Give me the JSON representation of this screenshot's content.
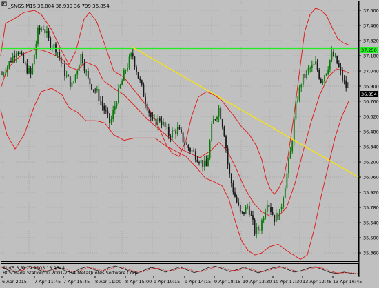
{
  "window": {
    "icon_name": "chart-window-icon",
    "title": "_SNGS,M15",
    "ohlc": "36.804 36.939 36.799 36.854"
  },
  "colors": {
    "background": "#c0c0c0",
    "grid": "#a8a8a8",
    "bull_candle": "#0a7a0a",
    "bear_candle": "#1a1a1a",
    "bollinger": "#e02020",
    "resistance_line": "#22ee22",
    "trend_line": "#f0e020",
    "price_tag": "#000000",
    "stochastic_main": "#1a1a1a",
    "stochastic_signal": "#e02020"
  },
  "indicator": {
    "label": "Sto(5,3,3) 19.3103 13.9544"
  },
  "footer": {
    "copyright": "BCS Trade Station, © 2001-2014 MetaQuotes Software Corp."
  },
  "chart_data": {
    "type": "candlestick",
    "symbol": "_SNGS",
    "timeframe": "M15",
    "y_ticks": [
      "37.600",
      "37.460",
      "37.320",
      "37.180",
      "37.040",
      "36.900",
      "36.760",
      "36.620",
      "36.480",
      "36.340",
      "36.200",
      "36.060",
      "35.920",
      "35.780",
      "35.640",
      "35.500",
      "35.360"
    ],
    "ylim": [
      35.36,
      37.6
    ],
    "x_ticks": [
      "6 Apr 2015",
      "7 Apr 11:45",
      "7 Apr 15:45",
      "8 Apr 11:00",
      "8 Apr 15:00",
      "9 Apr 10:15",
      "9 Apr 14:15",
      "9 Apr 18:15",
      "10 Apr 13:30",
      "10 Apr 17:30",
      "13 Apr 12:45",
      "13 Apr 16:45"
    ],
    "current_price": "36.854",
    "resistance_level": "37.250",
    "trend_line": {
      "start": [
        "8 Apr 15:00",
        37.26
      ],
      "end": [
        "13 Apr 16:45",
        36.06
      ]
    },
    "bollinger_upper": [
      [
        1,
        37.18
      ],
      [
        8,
        37.48
      ],
      [
        20,
        37.52
      ],
      [
        35,
        37.58
      ],
      [
        50,
        37.6
      ],
      [
        60,
        37.56
      ],
      [
        75,
        37.42
      ],
      [
        90,
        37.22
      ],
      [
        100,
        37.1
      ],
      [
        110,
        37.22
      ],
      [
        122,
        37.52
      ],
      [
        130,
        37.58
      ],
      [
        140,
        37.5
      ],
      [
        150,
        37.32
      ],
      [
        165,
        37.04
      ],
      [
        180,
        36.98
      ],
      [
        195,
        36.86
      ],
      [
        205,
        36.78
      ],
      [
        215,
        36.7
      ],
      [
        225,
        36.6
      ],
      [
        235,
        36.45
      ],
      [
        242,
        36.35
      ],
      [
        250,
        36.28
      ],
      [
        260,
        36.25
      ],
      [
        270,
        36.4
      ],
      [
        278,
        36.62
      ],
      [
        288,
        36.8
      ],
      [
        300,
        36.85
      ],
      [
        310,
        36.82
      ],
      [
        320,
        36.78
      ],
      [
        330,
        36.7
      ],
      [
        340,
        36.62
      ],
      [
        350,
        36.53
      ],
      [
        362,
        36.45
      ],
      [
        372,
        36.35
      ],
      [
        380,
        36.22
      ],
      [
        386,
        36.05
      ],
      [
        392,
        35.95
      ],
      [
        398,
        35.9
      ],
      [
        405,
        35.96
      ],
      [
        412,
        36.06
      ],
      [
        418,
        36.25
      ],
      [
        426,
        36.6
      ],
      [
        434,
        37.0
      ],
      [
        442,
        37.4
      ],
      [
        450,
        37.56
      ],
      [
        458,
        37.62
      ],
      [
        466,
        37.6
      ],
      [
        474,
        37.55
      ],
      [
        482,
        37.44
      ],
      [
        490,
        37.34
      ],
      [
        498,
        37.3
      ],
      [
        506,
        37.28
      ]
    ],
    "bollinger_middle": [
      [
        1,
        36.88
      ],
      [
        10,
        37.05
      ],
      [
        22,
        37.14
      ],
      [
        35,
        37.2
      ],
      [
        50,
        37.24
      ],
      [
        62,
        37.23
      ],
      [
        75,
        37.2
      ],
      [
        90,
        37.15
      ],
      [
        100,
        37.08
      ],
      [
        112,
        37.05
      ],
      [
        125,
        37.12
      ],
      [
        140,
        37.08
      ],
      [
        150,
        36.95
      ],
      [
        165,
        36.88
      ],
      [
        180,
        36.82
      ],
      [
        195,
        36.72
      ],
      [
        210,
        36.62
      ],
      [
        222,
        36.55
      ],
      [
        235,
        36.48
      ],
      [
        250,
        36.4
      ],
      [
        262,
        36.32
      ],
      [
        275,
        36.28
      ],
      [
        290,
        36.24
      ],
      [
        305,
        36.3
      ],
      [
        318,
        36.38
      ],
      [
        330,
        36.3
      ],
      [
        342,
        36.15
      ],
      [
        355,
        35.96
      ],
      [
        368,
        35.82
      ],
      [
        380,
        35.74
      ],
      [
        392,
        35.7
      ],
      [
        404,
        35.7
      ],
      [
        416,
        35.78
      ],
      [
        428,
        36.0
      ],
      [
        440,
        36.3
      ],
      [
        452,
        36.58
      ],
      [
        464,
        36.82
      ],
      [
        476,
        36.98
      ],
      [
        488,
        37.06
      ],
      [
        500,
        37.04
      ],
      [
        506,
        37.02
      ]
    ],
    "bollinger_lower": [
      [
        1,
        36.68
      ],
      [
        10,
        36.45
      ],
      [
        22,
        36.32
      ],
      [
        35,
        36.45
      ],
      [
        50,
        36.72
      ],
      [
        60,
        36.85
      ],
      [
        75,
        36.88
      ],
      [
        90,
        36.82
      ],
      [
        100,
        36.7
      ],
      [
        112,
        36.66
      ],
      [
        125,
        36.58
      ],
      [
        140,
        36.58
      ],
      [
        152,
        36.56
      ],
      [
        165,
        36.45
      ],
      [
        180,
        36.4
      ],
      [
        195,
        36.42
      ],
      [
        210,
        36.42
      ],
      [
        225,
        36.42
      ],
      [
        240,
        36.35
      ],
      [
        255,
        36.3
      ],
      [
        270,
        36.25
      ],
      [
        285,
        36.15
      ],
      [
        298,
        36.05
      ],
      [
        310,
        36.02
      ],
      [
        322,
        35.98
      ],
      [
        332,
        35.86
      ],
      [
        340,
        35.68
      ],
      [
        350,
        35.48
      ],
      [
        360,
        35.38
      ],
      [
        370,
        35.34
      ],
      [
        380,
        35.36
      ],
      [
        392,
        35.42
      ],
      [
        404,
        35.44
      ],
      [
        416,
        35.38
      ],
      [
        426,
        35.34
      ],
      [
        436,
        35.3
      ],
      [
        446,
        35.34
      ],
      [
        456,
        35.58
      ],
      [
        466,
        35.88
      ],
      [
        476,
        36.15
      ],
      [
        486,
        36.42
      ],
      [
        496,
        36.62
      ],
      [
        506,
        36.76
      ]
    ],
    "stochastic": [
      72,
      45,
      28,
      62,
      80,
      55,
      30,
      48,
      70,
      40,
      22,
      58,
      76,
      50,
      34,
      66,
      82,
      60,
      38,
      20,
      45,
      70,
      55,
      30,
      52,
      74,
      48,
      26,
      40,
      68,
      80,
      58,
      34,
      50,
      72,
      46,
      24,
      44,
      66,
      78,
      54,
      30,
      42,
      64,
      76,
      52,
      28,
      18,
      30,
      20,
      14
    ]
  }
}
